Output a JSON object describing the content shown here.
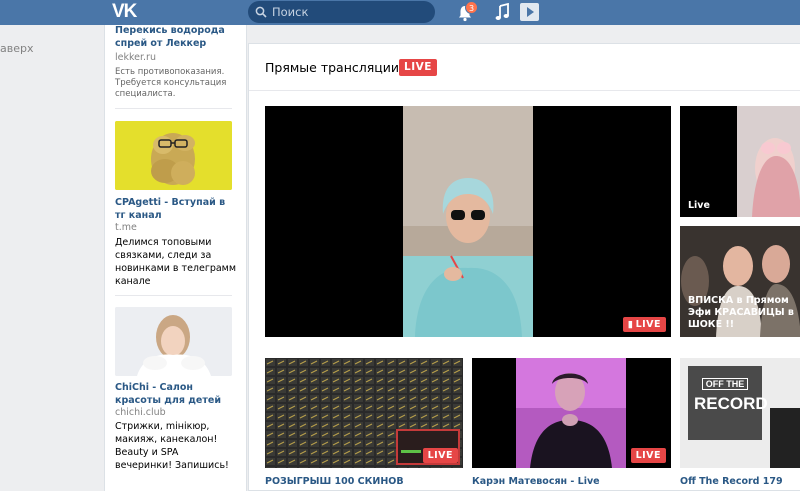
{
  "header": {
    "logo": "VK",
    "search_placeholder": "Поиск",
    "notifications_count": "3"
  },
  "left": {
    "up_link": "аверх"
  },
  "ads": [
    {
      "title": "Перекись водорода спрей от Леккер",
      "domain": "lekker.ru",
      "description": "Есть противопоказания. Требуется консультация специалиста."
    },
    {
      "title": "CPAgetti - Вступай в тг канал",
      "domain": "t.me",
      "description": "Делимся топовыми связками, следи за новинками в телеграмм канале"
    },
    {
      "title": "ChiChi - Салон красоты для детей",
      "domain": "chichi.club",
      "description": "Стрижки, mінікюр, макияж, канекалон! Beauty и SPA вечеринки! Запишись!"
    }
  ],
  "main": {
    "title": "Прямые трансляции",
    "live_tag": "LIVE",
    "tiles": [
      {
        "badge": "LIVE"
      },
      {
        "label": "Live"
      },
      {
        "overlay": "ВПИСКА в Прямом Эфи КРАСАВИЦЫ в ШОКЕ !!"
      },
      {
        "badge": "LIVE",
        "caption": "РОЗЫГРЫШ 100 СКИНОВ"
      },
      {
        "badge": "LIVE",
        "caption": "Карэн Матевосян - Live"
      },
      {
        "caption": "Off The Record 179",
        "logo_top": "OFF THE",
        "logo_bottom": "RECORD"
      }
    ]
  }
}
